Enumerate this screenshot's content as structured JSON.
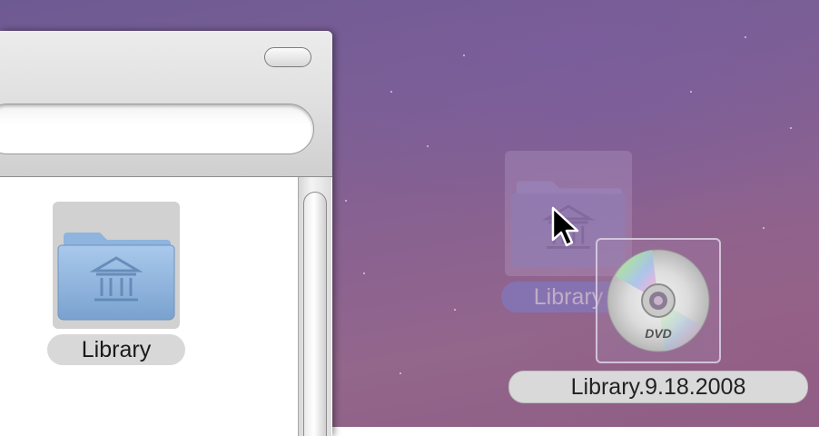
{
  "desktop": {
    "items": [
      {
        "label": "Library",
        "icon": "library-folder-icon",
        "state": "ghost-drag-source"
      },
      {
        "label": "Library.9.18.2008",
        "icon": "dvd-disc-icon",
        "state": "selected"
      }
    ]
  },
  "finder_window": {
    "items": [
      {
        "label": "Library",
        "icon": "library-folder-icon",
        "state": "selected"
      }
    ]
  },
  "colors": {
    "desktop_background": "#7c5f94",
    "folder_blue": "#8fb4dd",
    "label_highlight": "#7d7fcf"
  },
  "cursor": {
    "icon": "arrow-pointer-icon"
  }
}
